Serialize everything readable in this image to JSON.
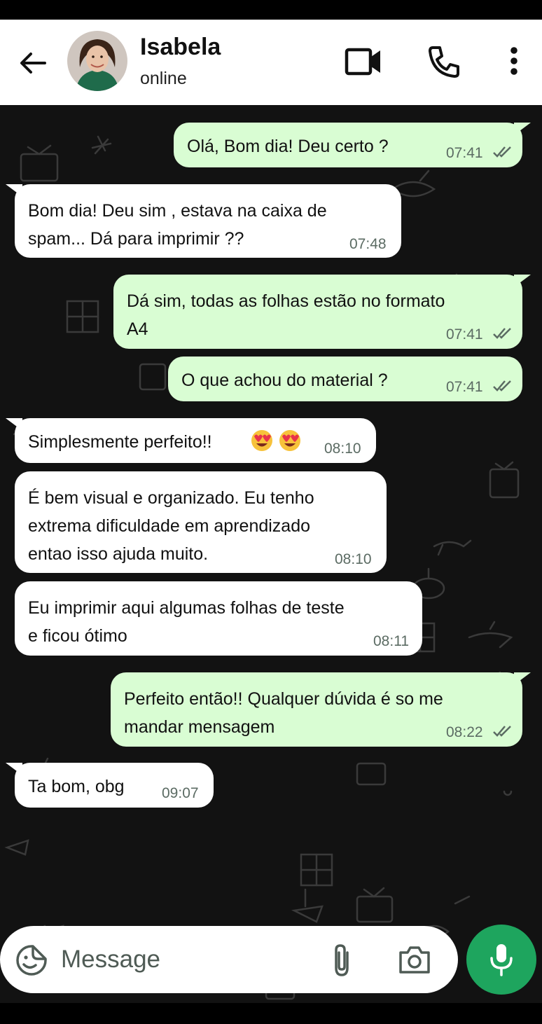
{
  "header": {
    "contact_name": "Isabela",
    "contact_status": "online",
    "icons": [
      "back-arrow-icon",
      "video-call-icon",
      "phone-icon",
      "more-vertical-icon"
    ]
  },
  "messages": [
    {
      "direction": "out",
      "text": "Olá, Bom dia! Deu certo ?",
      "time": "07:41",
      "status": "read"
    },
    {
      "direction": "in",
      "text": "Bom dia! Deu sim , estava na caixa de\nspam... Dá para imprimir ??",
      "time": "07:48"
    },
    {
      "direction": "out",
      "text": "Dá sim, todas as folhas estão no formato\nA4",
      "time": "07:41",
      "status": "read"
    },
    {
      "direction": "out",
      "text": "O que achou do material ?",
      "time": "07:41",
      "status": "read"
    },
    {
      "direction": "in",
      "text": "Simplesmente perfeito!!",
      "emoji_count": 2,
      "emoji": "smiling-face-with-heart-eyes",
      "time": "08:10"
    },
    {
      "direction": "in",
      "text": "É bem visual e organizado. Eu tenho\nextrema dificuldade em aprendizado\nentao isso ajuda muito.",
      "time": "08:10"
    },
    {
      "direction": "in",
      "text": "Eu imprimir aqui algumas folhas de teste\ne ficou ótimo",
      "time": "08:11"
    },
    {
      "direction": "out",
      "text": "Perfeito então!! Qualquer dúvida é so me\nmandar mensagem",
      "time": "08:22",
      "status": "read"
    },
    {
      "direction": "in",
      "text": "Ta bom, obg",
      "time": "09:07"
    }
  ],
  "composer": {
    "placeholder": "Message",
    "icons": [
      "emoji-sticker-icon",
      "attach-icon",
      "camera-icon",
      "mic-icon"
    ]
  },
  "colors": {
    "outgoing_bubble": "#d9fdd3",
    "incoming_bubble": "#ffffff",
    "chat_background": "#121212",
    "mic_button": "#1ea55e"
  }
}
